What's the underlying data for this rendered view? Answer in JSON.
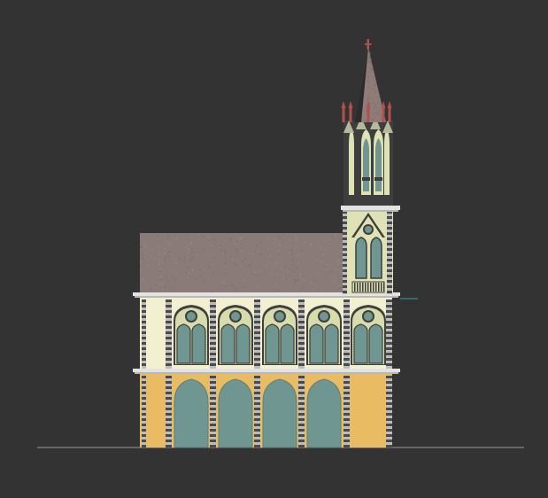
{
  "drawing": {
    "subject": "church-elevation",
    "colors": {
      "background": "#333333",
      "ground_line": "#9a9a9a",
      "roof": "#8a7a78",
      "roof_speckle": "#7b6b69",
      "upper_wall": "#f3f0d2",
      "lower_wall": "#e9bb63",
      "cornice": "#e3e3e3",
      "cornice_shadow": "#b9b9b9",
      "pier_dark": "#4a4a4a",
      "pier_light": "#bdbdbd",
      "window_glass": "#6f9690",
      "window_frame": "#3f3f3f",
      "tracery_fill": "#d8dcaa",
      "arch_fill": "#6f9690",
      "tower_dark": "#3e3e3e",
      "tower_light": "#dfe2b4",
      "spire": "#8f7c78",
      "spire_shadow": "#2c2c2c",
      "finial": "#b0514e",
      "teal_mark": "#2fa7a3"
    },
    "upper_bay_count": 5,
    "lower_arch_count": 4,
    "tower_pinnacle_count": 5
  }
}
